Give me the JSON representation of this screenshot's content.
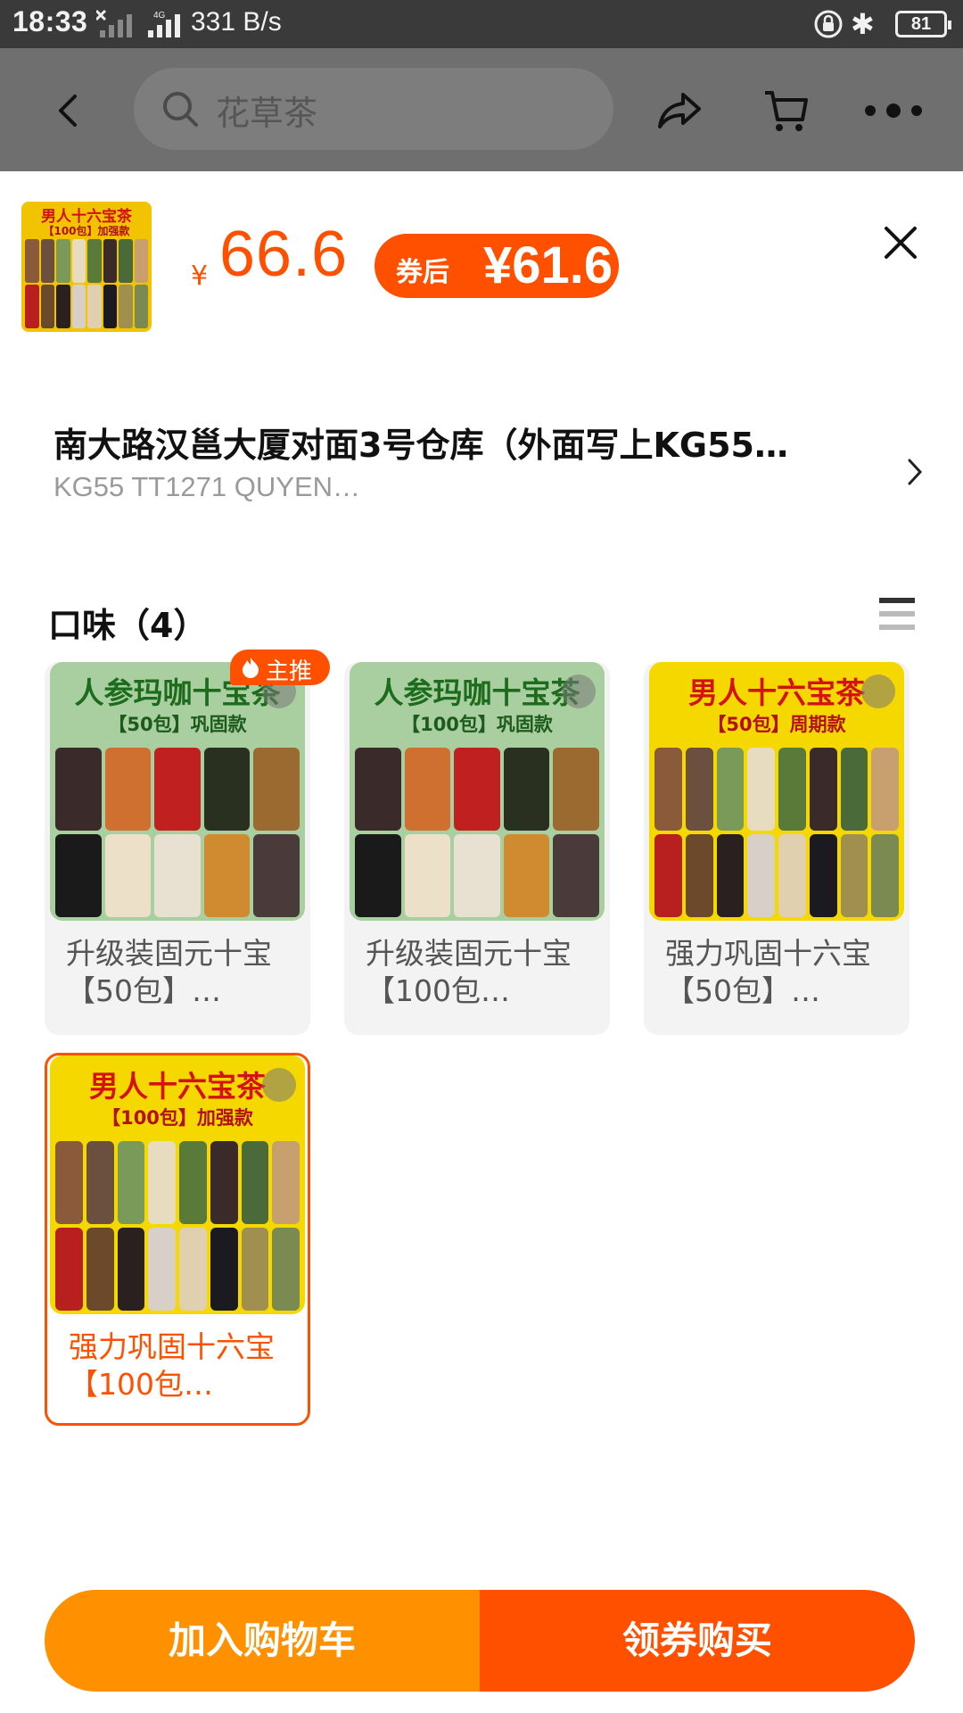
{
  "status_bar": {
    "time": "18:33",
    "signal": "4G",
    "net_speed": "331 B/s",
    "battery": "81"
  },
  "header": {
    "search_placeholder": "花草茶",
    "icons": [
      "back-icon",
      "search-icon",
      "share-icon",
      "cart-icon",
      "more-icon"
    ]
  },
  "sheet": {
    "thumb": {
      "title": "男人十六宝茶",
      "subtitle": "【100包】加强款"
    },
    "price_symbol": "¥",
    "price": "66.6",
    "coupon_label": "券后",
    "coupon_price": "¥61.6",
    "address_line1": "南大路汉邕大厦对面3号仓库（外面写上KG55…",
    "address_line2": "KG55 TT1271 QUYEN…",
    "section_title": "口味（4）",
    "hot_badge": "主推",
    "options": [
      {
        "image_title": "人参玛咖十宝茶",
        "image_subtitle": "【50包】巩固款",
        "caption": "升级装固元十宝【50包】…",
        "theme": "green",
        "selected": false
      },
      {
        "image_title": "人参玛咖十宝茶",
        "image_subtitle": "【100包】巩固款",
        "caption": "升级装固元十宝【100包…",
        "theme": "green",
        "selected": false
      },
      {
        "image_title": "男人十六宝茶",
        "image_subtitle": "【50包】周期款",
        "caption": "强力巩固十六宝【50包】…",
        "theme": "yellow",
        "selected": false
      },
      {
        "image_title": "男人十六宝茶",
        "image_subtitle": "【100包】加强款",
        "caption": "强力巩固十六宝【100包…",
        "theme": "yellow",
        "selected": true
      }
    ]
  },
  "buttons": {
    "add_to_cart": "加入购物车",
    "buy_with_coupon": "领券购买"
  },
  "colors": {
    "accent": "#ff5000",
    "cart_button": "#ff9000"
  }
}
